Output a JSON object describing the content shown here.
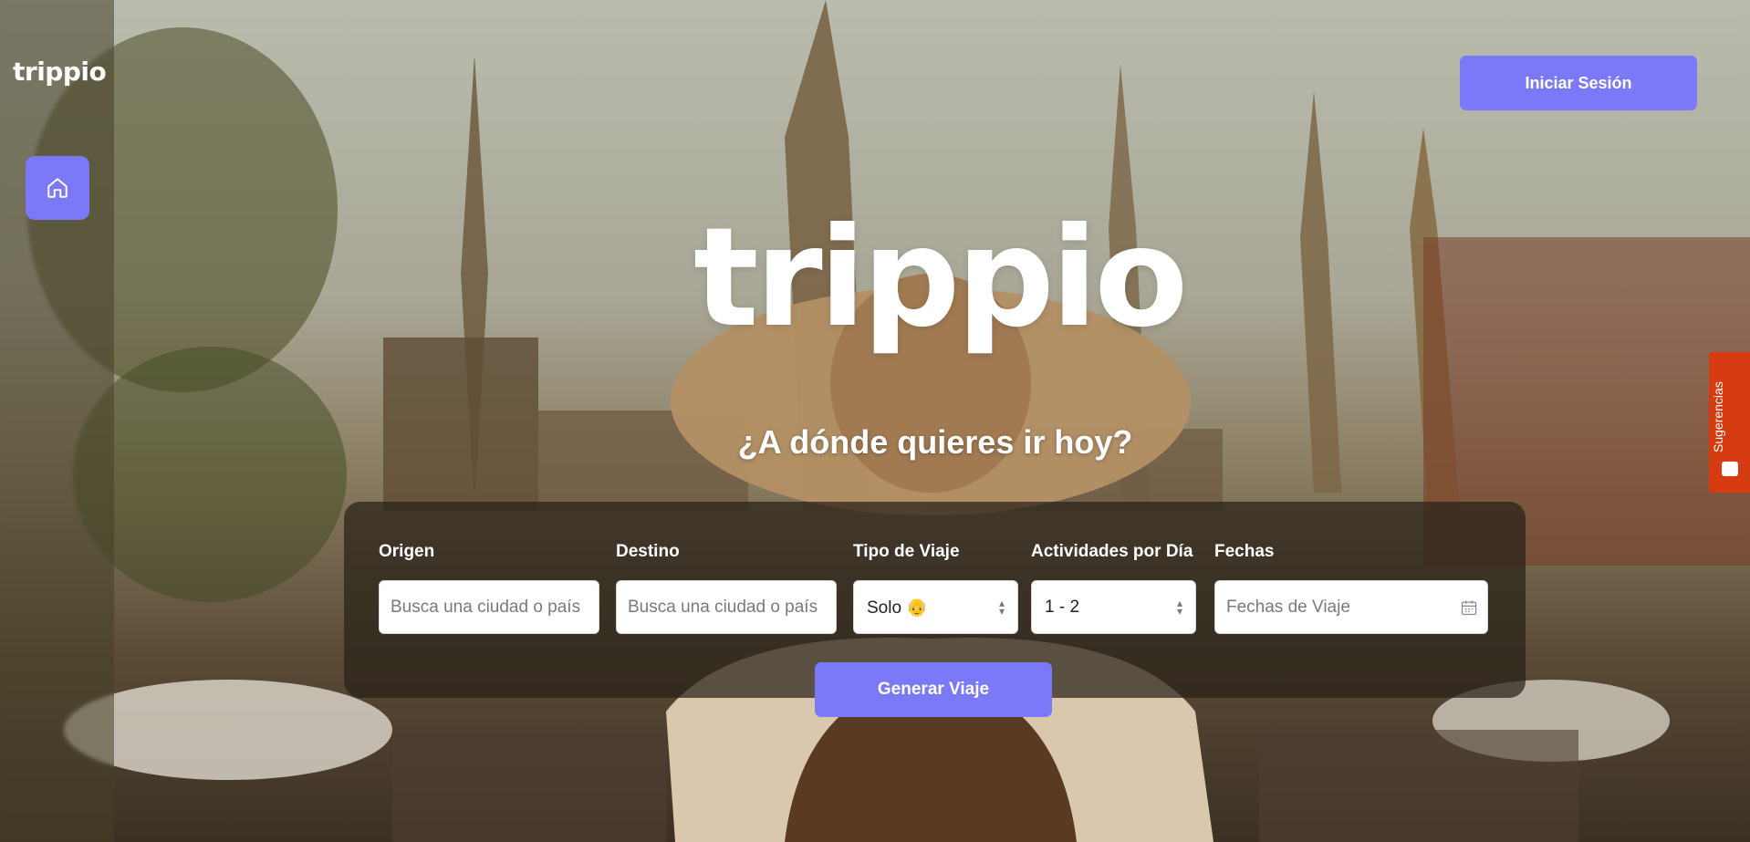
{
  "app": {
    "logo_text": "trippio"
  },
  "header": {
    "login_label": "Iniciar Sesión"
  },
  "hero": {
    "title": "trippio",
    "subtitle": "¿A dónde quieres ir hoy?"
  },
  "search": {
    "origin": {
      "label": "Origen",
      "placeholder": "Busca una ciudad o país"
    },
    "destination": {
      "label": "Destino",
      "placeholder": "Busca una ciudad o país"
    },
    "trip_type": {
      "label": "Tipo de Viaje",
      "value": "Solo 👴"
    },
    "activities": {
      "label": "Actividades por Día",
      "value": "1 - 2"
    },
    "dates": {
      "label": "Fechas",
      "placeholder": "Fechas de Viaje"
    },
    "generate_label": "Generar Viaje"
  },
  "feedback": {
    "label": "Sugerencias"
  },
  "colors": {
    "accent": "#7b79f7",
    "feedback": "#d63b11"
  },
  "icons": {
    "home": "home-icon",
    "calendar": "calendar-icon",
    "select_caret": "chevron-up-down-icon",
    "feedback": "feedback-icon"
  }
}
